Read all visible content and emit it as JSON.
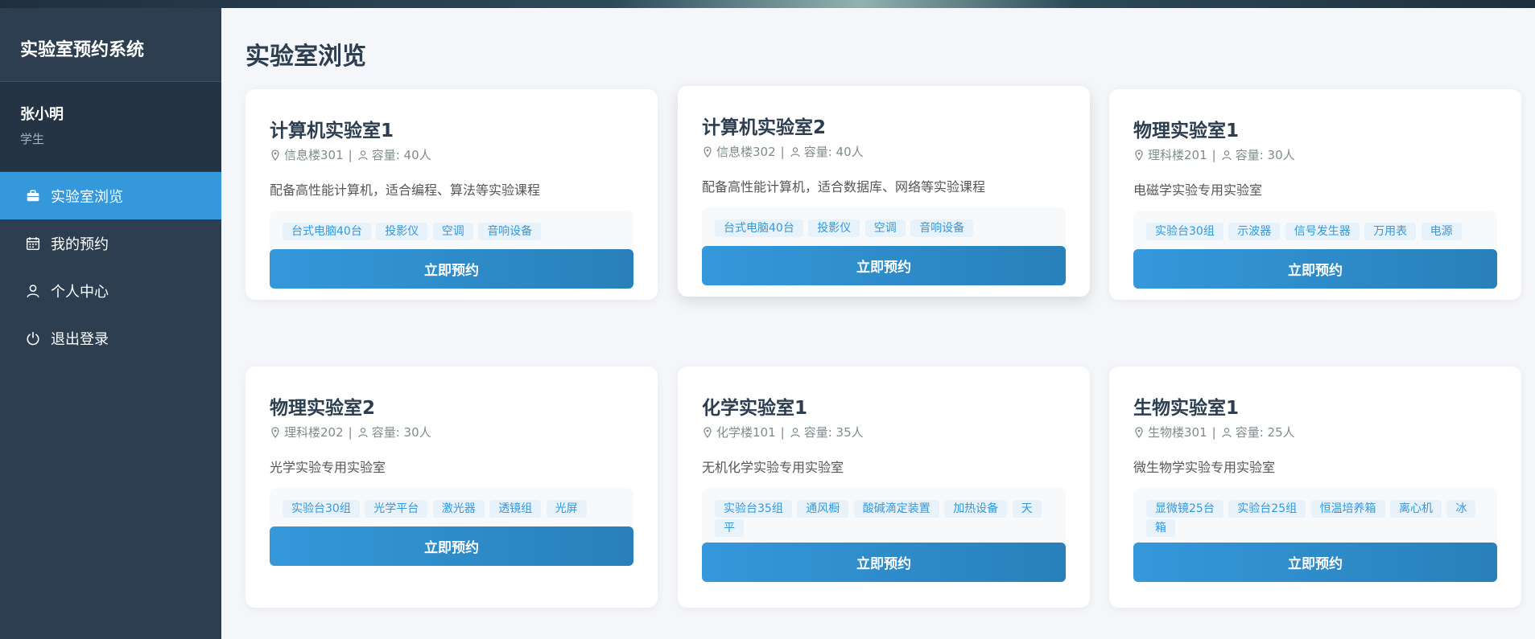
{
  "app": {
    "title": "实验室预约系统"
  },
  "user": {
    "name": "张小明",
    "role": "学生"
  },
  "menu": [
    {
      "label": "实验室浏览",
      "icon": "briefcase-icon",
      "active": true
    },
    {
      "label": "我的预约",
      "icon": "calendar-icon",
      "active": false
    },
    {
      "label": "个人中心",
      "icon": "user-icon",
      "active": false
    },
    {
      "label": "退出登录",
      "icon": "power-icon",
      "active": false
    }
  ],
  "page": {
    "title": "实验室浏览"
  },
  "labs": [
    {
      "name": "计算机实验室1",
      "location": "信息楼301",
      "capacity": "容量: 40人",
      "description": "配备高性能计算机，适合编程、算法等实验课程",
      "equipment": [
        "台式电脑40台",
        "投影仪",
        "空调",
        "音响设备"
      ],
      "button": "立即预约"
    },
    {
      "name": "计算机实验室2",
      "location": "信息楼302",
      "capacity": "容量: 40人",
      "description": "配备高性能计算机，适合数据库、网络等实验课程",
      "equipment": [
        "台式电脑40台",
        "投影仪",
        "空调",
        "音响设备"
      ],
      "button": "立即预约"
    },
    {
      "name": "物理实验室1",
      "location": "理科楼201",
      "capacity": "容量: 30人",
      "description": "电磁学实验专用实验室",
      "equipment": [
        "实验台30组",
        "示波器",
        "信号发生器",
        "万用表",
        "电源"
      ],
      "button": "立即预约"
    },
    {
      "name": "物理实验室2",
      "location": "理科楼202",
      "capacity": "容量: 30人",
      "description": "光学实验专用实验室",
      "equipment": [
        "实验台30组",
        "光学平台",
        "激光器",
        "透镜组",
        "光屏"
      ],
      "button": "立即预约"
    },
    {
      "name": "化学实验室1",
      "location": "化学楼101",
      "capacity": "容量: 35人",
      "description": "无机化学实验专用实验室",
      "equipment": [
        "实验台35组",
        "通风橱",
        "酸碱滴定装置",
        "加热设备",
        "天平"
      ],
      "button": "立即预约"
    },
    {
      "name": "生物实验室1",
      "location": "生物楼301",
      "capacity": "容量: 25人",
      "description": "微生物学实验专用实验室",
      "equipment": [
        "显微镜25台",
        "实验台25组",
        "恒温培养箱",
        "离心机",
        "冰箱"
      ],
      "button": "立即预约"
    }
  ]
}
